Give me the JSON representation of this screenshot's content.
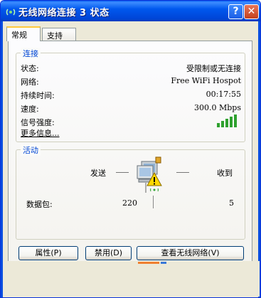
{
  "window": {
    "title": "无线网络连接 3 状态",
    "help_label": "?",
    "close_label": "✕",
    "title_icon": "wireless-network-icon"
  },
  "tabs": [
    {
      "label": "常规",
      "active": true
    },
    {
      "label": "支持",
      "active": false
    }
  ],
  "connection": {
    "legend": "连接",
    "rows": [
      {
        "label": "状态:",
        "value": "受限制或无连接"
      },
      {
        "label": "网络:",
        "value": "Free WiFi Hospot"
      },
      {
        "label": "持续时间:",
        "value": "00:17:55"
      },
      {
        "label": "速度:",
        "value": "300.0 Mbps"
      },
      {
        "label": "信号强度:",
        "value": ""
      }
    ],
    "signal_icon": "signal-strength-icon",
    "signal_bars": 5,
    "signal_level": 5,
    "more_info": "更多信息..."
  },
  "activity": {
    "legend": "活动",
    "sent_label": "发送",
    "received_label": "收到",
    "packets_label": "数据包:",
    "packets_sent": "220",
    "packets_received": "5",
    "icon": "network-computer-warning-icon"
  },
  "buttons": {
    "properties": "属性(P)",
    "disable": "禁用(D)",
    "view_networks": "查看无线网络(V)"
  },
  "colors": {
    "title_bar": "#0058ee",
    "accent_blue": "#0046d5",
    "signal_green": "#2fa12f",
    "tab_highlight": "#ffc83c",
    "warning_yellow": "#ffd800"
  }
}
